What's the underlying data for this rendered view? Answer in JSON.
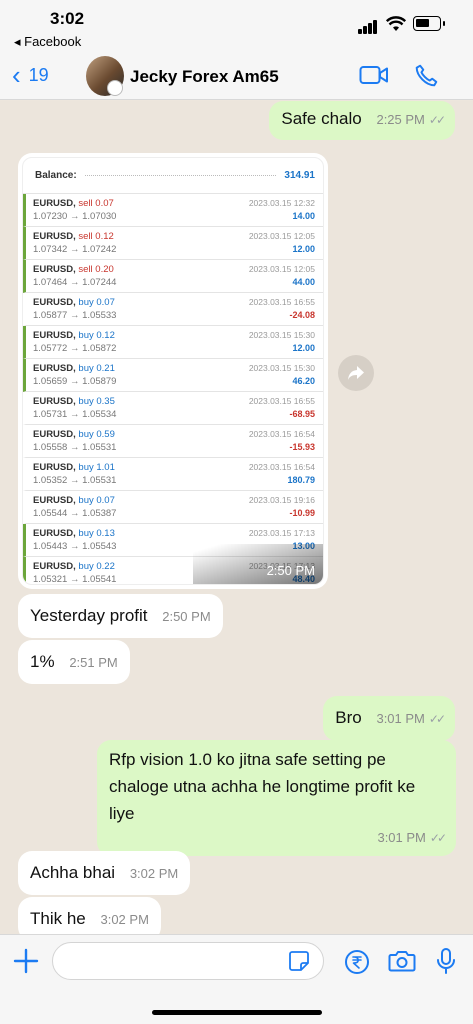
{
  "status_bar": {
    "time": "3:02",
    "back_app": "◂ Facebook"
  },
  "header": {
    "back_count": "19",
    "contact_name": "Jecky Forex Am65"
  },
  "messages": {
    "m1": {
      "text": "Safe chalo",
      "time": "2:25 PM"
    },
    "image": {
      "balance_label": "Balance:",
      "balance_value": "314.91",
      "time": "2:50 PM",
      "trades": [
        {
          "symbol": "EURUSD,",
          "side": "sell 0.07",
          "prices": "1.07230 → 1.07030",
          "date": "2023.03.15 12:32",
          "profit": "14.00"
        },
        {
          "symbol": "EURUSD,",
          "side": "sell 0.12",
          "prices": "1.07342 → 1.07242",
          "date": "2023.03.15 12:05",
          "profit": "12.00"
        },
        {
          "symbol": "EURUSD,",
          "side": "sell 0.20",
          "prices": "1.07464 → 1.07244",
          "date": "2023.03.15 12:05",
          "profit": "44.00"
        },
        {
          "symbol": "EURUSD,",
          "side": "buy 0.07",
          "prices": "1.05877 → 1.05533",
          "date": "2023.03.15 16:55",
          "profit": "-24.08"
        },
        {
          "symbol": "EURUSD,",
          "side": "buy 0.12",
          "prices": "1.05772 → 1.05872",
          "date": "2023.03.15 15:30",
          "profit": "12.00"
        },
        {
          "symbol": "EURUSD,",
          "side": "buy 0.21",
          "prices": "1.05659 → 1.05879",
          "date": "2023.03.15 15:30",
          "profit": "46.20"
        },
        {
          "symbol": "EURUSD,",
          "side": "buy 0.35",
          "prices": "1.05731 → 1.05534",
          "date": "2023.03.15 16:55",
          "profit": "-68.95"
        },
        {
          "symbol": "EURUSD,",
          "side": "buy 0.59",
          "prices": "1.05558 → 1.05531",
          "date": "2023.03.15 16:54",
          "profit": "-15.93"
        },
        {
          "symbol": "EURUSD,",
          "side": "buy 1.01",
          "prices": "1.05352 → 1.05531",
          "date": "2023.03.15 16:54",
          "profit": "180.79"
        },
        {
          "symbol": "EURUSD,",
          "side": "buy 0.07",
          "prices": "1.05544 → 1.05387",
          "date": "2023.03.15 19:16",
          "profit": "-10.99"
        },
        {
          "symbol": "EURUSD,",
          "side": "buy 0.13",
          "prices": "1.05443 → 1.05543",
          "date": "2023.03.15 17:13",
          "profit": "13.00"
        },
        {
          "symbol": "EURUSD,",
          "side": "buy 0.22",
          "prices": "1.05321 → 1.05541",
          "date": "2023.03.15 17:13",
          "profit": "48.40"
        }
      ]
    },
    "m2": {
      "text": "Yesterday profit",
      "time": "2:50 PM"
    },
    "m3": {
      "text": "1%",
      "time": "2:51 PM"
    },
    "m4": {
      "text": "Bro",
      "time": "3:01 PM"
    },
    "m5": {
      "text": "Rfp vision 1.0 ko jitna safe setting pe chaloge utna achha he longtime profit ke liye",
      "time": "3:01 PM"
    },
    "m6": {
      "text": "Achha bhai",
      "time": "3:02 PM"
    },
    "m7": {
      "text": "Thik he",
      "time": "3:02 PM"
    }
  },
  "input": {
    "placeholder": ""
  },
  "colors": {
    "accent": "#1c7bf2",
    "outgoing_bubble": "#dcf8c6",
    "incoming_bubble": "#ffffff",
    "chat_bg": "#ece5dc"
  }
}
